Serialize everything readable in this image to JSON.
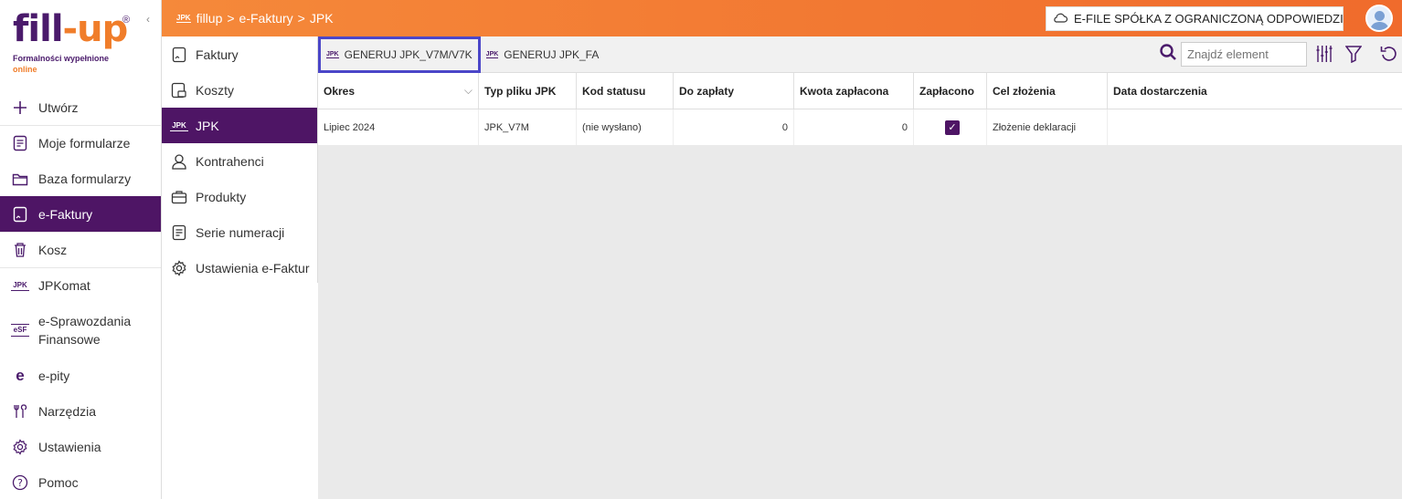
{
  "logo": {
    "brand_fill": "fill",
    "brand_up": "up",
    "registered": "®",
    "tagline_1": "Formalności wypełnione",
    "tagline_2": "online",
    "collapse": "‹"
  },
  "main_nav": [
    {
      "label": "Utwórz",
      "icon": "plus-icon"
    },
    {
      "label": "Moje formularze",
      "icon": "document-icon"
    },
    {
      "label": "Baza formularzy",
      "icon": "folder-icon"
    },
    {
      "label": "e-Faktury",
      "icon": "invoice-icon",
      "active": true
    },
    {
      "label": "Kosz",
      "icon": "trash-icon"
    },
    {
      "label": "JPKomat",
      "icon": "jpk-icon"
    },
    {
      "label": "e-Sprawozdania\nFinansowe",
      "icon": "esf-icon"
    },
    {
      "label": "e-pity",
      "icon": "epity-icon"
    },
    {
      "label": "Narzędzia",
      "icon": "tools-icon"
    },
    {
      "label": "Ustawienia",
      "icon": "gear-icon"
    },
    {
      "label": "Pomoc",
      "icon": "help-icon"
    }
  ],
  "icon_glyphs": {
    "jpk": "JPK",
    "esf": "eSF",
    "epity": "e"
  },
  "breadcrumb": {
    "root": "fillup",
    "level1": "e-Faktury",
    "level2": "JPK",
    "separator": ">"
  },
  "company": {
    "name": "E-FILE SPÓŁKA Z OGRANICZONĄ ODPOWIEDZI..."
  },
  "sub_nav": [
    {
      "label": "Faktury",
      "icon": "invoice-icon"
    },
    {
      "label": "Koszty",
      "icon": "costs-icon"
    },
    {
      "label": "JPK",
      "icon": "jpk-icon",
      "active": true
    },
    {
      "label": "Kontrahenci",
      "icon": "user-icon"
    },
    {
      "label": "Produkty",
      "icon": "briefcase-icon"
    },
    {
      "label": "Serie numeracji",
      "icon": "document-icon"
    },
    {
      "label": "Ustawienia e-Faktur",
      "icon": "gear-icon"
    }
  ],
  "toolbar": {
    "btn_v7m": "GENERUJ JPK_V7M/V7K",
    "btn_fa": "GENERUJ JPK_FA",
    "search_placeholder": "Znajdź element"
  },
  "table": {
    "columns": [
      "Okres",
      "Typ pliku JPK",
      "Kod statusu",
      "Do zapłaty",
      "Kwota zapłacona",
      "Zapłacono",
      "Cel złożenia",
      "Data dostarczenia"
    ],
    "rows": [
      {
        "okres": "Lipiec 2024",
        "typ": "JPK_V7M",
        "kod": "(nie wysłano)",
        "do_zaplaty": "0",
        "kwota": "0",
        "zaplacono": true,
        "cel": "Złożenie deklaracji",
        "data": ""
      }
    ]
  },
  "colors": {
    "accent_purple": "#4e1565",
    "accent_orange": "#f06b2c",
    "focus_blue": "#4b46c8"
  }
}
